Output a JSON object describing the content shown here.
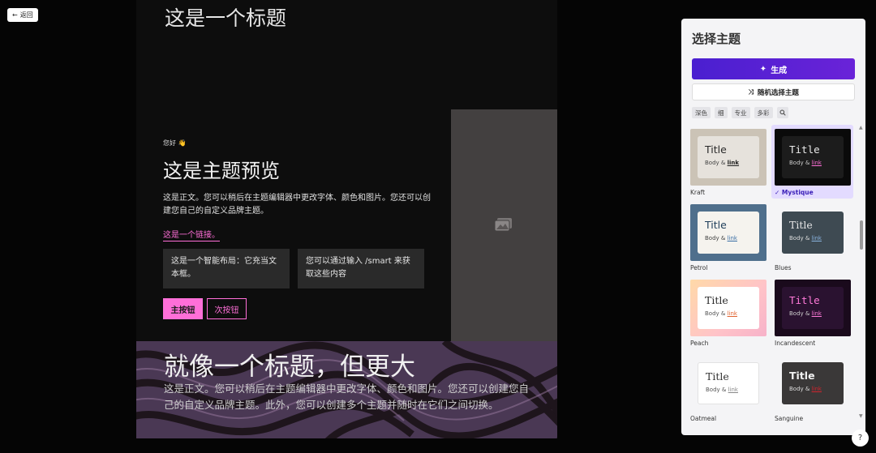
{
  "back_button": {
    "icon": "arrow-left-icon",
    "label": "返回"
  },
  "preview": {
    "top_heading": "这是一个标题",
    "greeting": "您好 👋",
    "title": "这是主题预览",
    "body": "这是正文。您可以稍后在主题编辑器中更改字体、颜色和图片。您还可以创建您自己的自定义品牌主题。",
    "link": "这是一个链接。",
    "smart_boxes": [
      "这是一个智能布局：它充当文本框。",
      "您可以通过输入 /smart 来获取这些内容"
    ],
    "primary_button": "主按钮",
    "secondary_button": "次按钮",
    "image_placeholder_icon": "image-icon",
    "big_title": "就像一个标题，但更大",
    "big_body": "这是正文。您可以稍后在主题编辑器中更改字体、颜色和图片。您还可以创建您自己的自定义品牌主题。此外，您可以创建多个主题并随时在它们之间切换。",
    "accent_color": "#ff6fd8"
  },
  "panel": {
    "title": "选择主题",
    "generate_button": "生成",
    "generate_icon": "sparkle-icon",
    "random_button": "随机选择主题",
    "random_icon": "shuffle-icon",
    "tags": [
      "深色",
      "细",
      "专业",
      "多彩"
    ],
    "search_icon": "search-icon",
    "selected_theme": "Mystique",
    "themes": [
      {
        "name": "Kraft",
        "title": "Title",
        "body": "Body &",
        "link": "link"
      },
      {
        "name": "Mystique",
        "title": "Title",
        "body": "Body &",
        "link": "link"
      },
      {
        "name": "Petrol",
        "title": "Title",
        "body": "Body &",
        "link": "link"
      },
      {
        "name": "Blues",
        "title": "Title",
        "body": "Body &",
        "link": "link"
      },
      {
        "name": "Peach",
        "title": "Title",
        "body": "Body &",
        "link": "link"
      },
      {
        "name": "Incandescent",
        "title": "Title",
        "body": "Body &",
        "link": "link"
      },
      {
        "name": "Oatmeal",
        "title": "Title",
        "body": "Body &",
        "link": "link"
      },
      {
        "name": "Sanguine",
        "title": "Title",
        "body": "Body &",
        "link": "link"
      }
    ],
    "check_icon": "check-icon"
  },
  "help_button": "?"
}
